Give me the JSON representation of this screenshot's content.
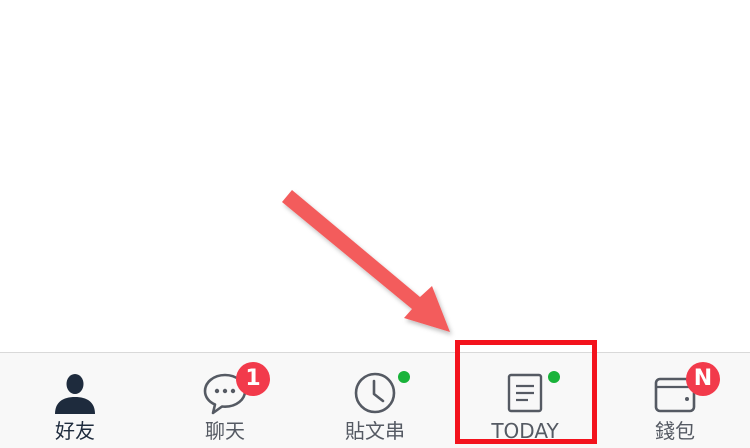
{
  "tabs": [
    {
      "id": "friends",
      "label": "好友",
      "icon": "person-icon",
      "active": true
    },
    {
      "id": "chats",
      "label": "聊天",
      "icon": "chat-bubble-icon",
      "badge": "1"
    },
    {
      "id": "timeline",
      "label": "貼文串",
      "icon": "clock-icon",
      "dot": true
    },
    {
      "id": "today",
      "label": "TODAY",
      "icon": "news-document-icon",
      "dot": true
    },
    {
      "id": "wallet",
      "label": "錢包",
      "icon": "wallet-icon",
      "badge": "N"
    }
  ],
  "annotation": {
    "arrow_color": "#f35c5c",
    "box_color": "#f3131d",
    "target_tab": "today"
  },
  "colors": {
    "tab_active": "#1e2b3d",
    "tab_inactive": "#555a63",
    "badge": "#f23a4b",
    "dot": "#19b33a"
  }
}
